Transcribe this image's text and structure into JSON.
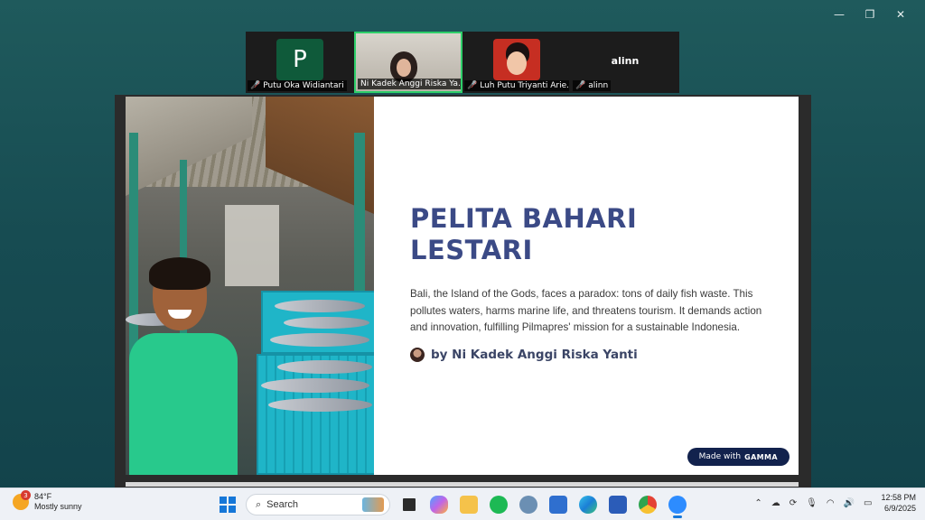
{
  "window": {
    "minimize": "—",
    "restore": "❐",
    "close": "✕"
  },
  "participants": [
    {
      "name": "Putu Oka Widiantari",
      "initial": "P",
      "muted": true
    },
    {
      "name": "Ni Kadek Anggi Riska Ya...",
      "active": true,
      "muted": false
    },
    {
      "name": "Luh Putu Triyanti Arie...",
      "muted": true
    },
    {
      "name": "alinn",
      "display_name": "alinn",
      "muted": true
    }
  ],
  "slide": {
    "title_line1": "PELITA BAHARI",
    "title_line2": "LESTARI",
    "description": " Bali, the Island of the Gods, faces a paradox: tons of daily fish waste. This pollutes waters, harms marine life, and threatens tourism. It demands action and innovation, fulfilling Pilmapres' mission for a sustainable Indonesia.",
    "byline": "by Ni Kadek Anggi Riska Yanti",
    "badge_prefix": "Made with",
    "badge_brand": "GAMMA"
  },
  "taskbar": {
    "weather_temp": "84°F",
    "weather_desc": "Mostly sunny",
    "weather_badge": "3",
    "search_placeholder": "Search",
    "time": "12:58 PM",
    "date": "6/9/2025"
  },
  "colors": {
    "title": "#3b4a86",
    "badge_bg": "#12224d",
    "active_tile_border": "#2ecf6a"
  }
}
